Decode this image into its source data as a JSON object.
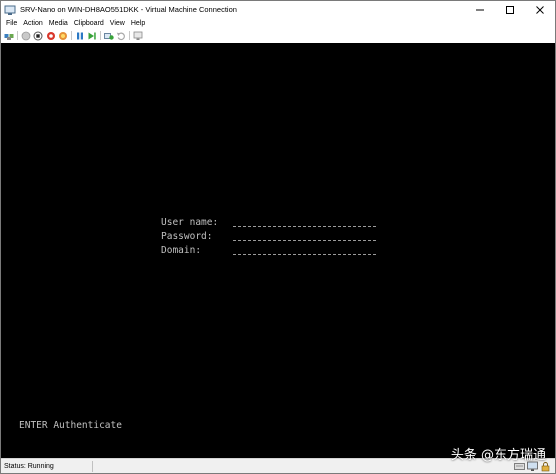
{
  "window": {
    "title": "SRV-Nano on WIN-DH8AO551DKK - Virtual Machine Connection"
  },
  "menu": [
    "File",
    "Action",
    "Media",
    "Clipboard",
    "View",
    "Help"
  ],
  "toolbar_icons": [
    "ctrl-alt-del-icon",
    "start-icon",
    "turn-off-icon",
    "shut-down-icon",
    "save-icon",
    "pause-icon",
    "reset-icon",
    "checkpoint-icon",
    "revert-icon",
    "enhanced-session-icon"
  ],
  "console": {
    "login": {
      "username_label": "User name:",
      "password_label": "Password:",
      "domain_label": "Domain:"
    },
    "hint": "ENTER Authenticate"
  },
  "status": {
    "text": "Status: Running"
  },
  "watermark": "头条 @东方瑞通",
  "colors": {
    "console_bg": "#000000",
    "console_text": "#c0c0c0",
    "window_bg": "#ffffff",
    "statusbar_bg": "#f0f0f0"
  }
}
